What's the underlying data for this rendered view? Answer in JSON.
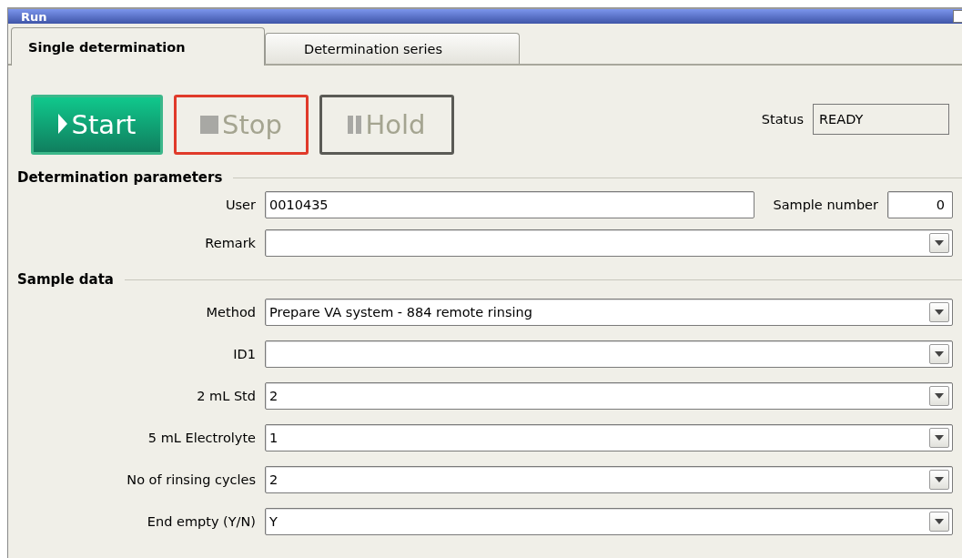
{
  "window": {
    "title": "Run"
  },
  "tabs": [
    {
      "label": "Single determination",
      "selected": true
    },
    {
      "label": "Determination series",
      "selected": false
    }
  ],
  "buttons": [
    {
      "kind": "start",
      "label": "Start",
      "disabled": false
    },
    {
      "kind": "stop",
      "label": "Stop",
      "disabled": true
    },
    {
      "kind": "hold",
      "label": "Hold",
      "disabled": true
    }
  ],
  "status": {
    "label": "Status",
    "value": "READY"
  },
  "sections": [
    {
      "title": "Determination parameters",
      "rows": [
        {
          "fields": [
            {
              "label": "User",
              "kind": "text",
              "value": "0010435"
            },
            {
              "label": "Sample number",
              "kind": "number",
              "value": "0"
            }
          ]
        },
        {
          "fields": [
            {
              "label": "Remark",
              "kind": "combo"
            }
          ]
        }
      ]
    },
    {
      "title": "Sample data",
      "rows": [
        {
          "fields": [
            {
              "label": "Method",
              "kind": "combo",
              "value": "Prepare VA system - 884 remote rinsing"
            }
          ]
        },
        {
          "fields": [
            {
              "label": "ID1",
              "kind": "combo"
            }
          ]
        },
        {
          "fields": [
            {
              "label": "2 mL Std",
              "kind": "combo",
              "value": "2"
            }
          ]
        },
        {
          "fields": [
            {
              "label": "5 mL Electrolyte",
              "kind": "combo",
              "value": "1"
            }
          ]
        },
        {
          "fields": [
            {
              "label": "No of rinsing cycles",
              "kind": "combo",
              "value": "2"
            }
          ]
        },
        {
          "fields": [
            {
              "label": "End empty (Y/N)",
              "kind": "combo",
              "value": "Y"
            }
          ]
        }
      ]
    }
  ]
}
